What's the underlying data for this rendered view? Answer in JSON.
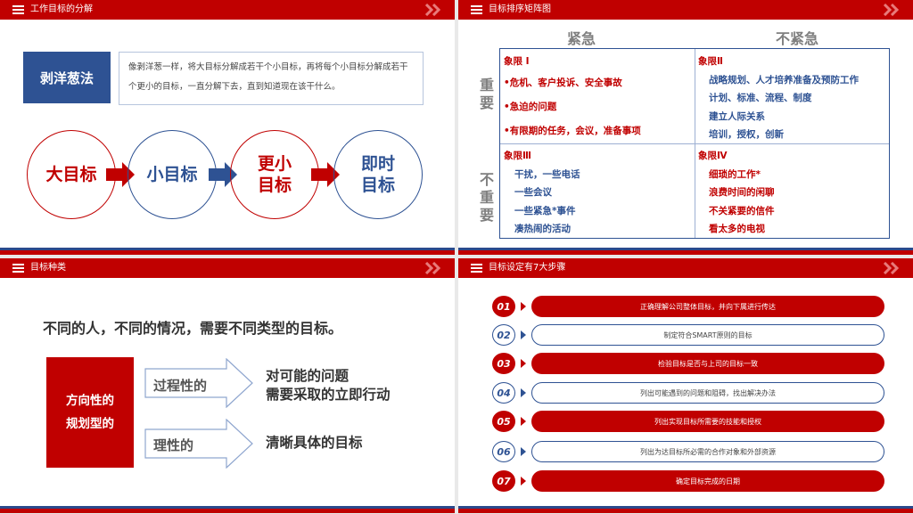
{
  "slide1": {
    "header": "工作目标的分解",
    "method": "剥洋葱法",
    "description": "像剥洋葱一样，将大目标分解成若干个小目标，再将每个小目标分解成若干个更小的目标，一直分解下去，直到知道现在该干什么。",
    "circles": [
      {
        "label": "大目标"
      },
      {
        "label": "小目标"
      },
      {
        "label": "更小\n目标"
      },
      {
        "label": "即时\n目标"
      }
    ]
  },
  "slide2": {
    "header": "目标排序矩阵图",
    "col_urgent": "紧急",
    "col_not_urgent": "不紧急",
    "row_important": "重要",
    "row_not_important": "不重要",
    "q1": {
      "title": "象限 I",
      "items": [
        "•危机、客户投诉、安全事故",
        "•急迫的问题",
        "•有限期的任务，会议，准备事项"
      ]
    },
    "q2": {
      "title": "象限Ⅱ",
      "items": [
        "战略规划、人才培养准备及预防工作",
        "计划、标准、流程、制度",
        "建立人际关系",
        "培训，授权，创新"
      ]
    },
    "q3": {
      "title": "象限Ⅲ",
      "items": [
        "干扰，一些电话",
        "一些会议",
        "一些紧急*事件",
        "凑热闹的活动"
      ]
    },
    "q4": {
      "title": "象限Ⅳ",
      "items": [
        "细琐的工作*",
        "浪费时间的闲聊",
        "不关紧要的信件",
        "看太多的电视"
      ]
    }
  },
  "slide3": {
    "header": "目标种类",
    "title": "不同的人，不同的情况，需要不同类型的目标。",
    "category": "方向性的\n规划型的",
    "types": [
      {
        "label": "过程性的",
        "desc": "对可能的问题\n需要采取的立即行动"
      },
      {
        "label": "理性的",
        "desc": "清晰具体的目标"
      }
    ]
  },
  "slide4": {
    "header": "目标设定有7大步骤",
    "steps": [
      {
        "num": "01",
        "text": "正确理解公司整体目标，并向下属进行传达"
      },
      {
        "num": "02",
        "text": "制定符合SMART原则的目标"
      },
      {
        "num": "03",
        "text": "检验目标是否与上司的目标一致"
      },
      {
        "num": "04",
        "text": "列出可能遇到的问题和阻碍，找出解决办法"
      },
      {
        "num": "05",
        "text": "列出实现目标所需要的技能和授权"
      },
      {
        "num": "06",
        "text": "列出为达目标所必需的合作对象和外部资源"
      },
      {
        "num": "07",
        "text": "确定目标完成的日期"
      }
    ]
  },
  "colors": {
    "red": "#c00000",
    "blue": "#2e5293"
  },
  "icons": {
    "header_menu": "menu-icon",
    "header_chevrons": "double-chevron-icon"
  }
}
